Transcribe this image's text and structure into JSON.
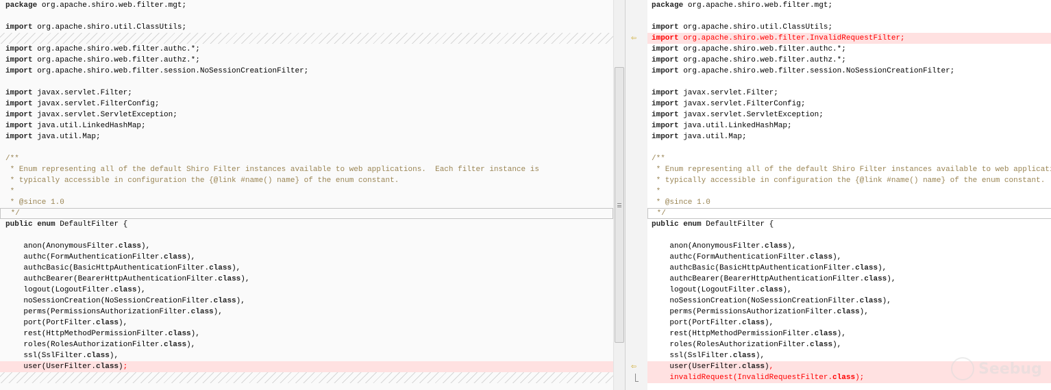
{
  "colors": {
    "added_bg": "#ffe1e1",
    "changed_text": "#ff0000",
    "comment": "#9a8554",
    "marker": "#c9a21a"
  },
  "left": {
    "lines": [
      {
        "t": "package org.apache.shiro.web.filter.mgt;"
      },
      {
        "t": ""
      },
      {
        "t": "import org.apache.shiro.util.ClassUtils;"
      },
      {
        "t": "",
        "kind": "hatch"
      },
      {
        "t": "import org.apache.shiro.web.filter.authc.*;"
      },
      {
        "t": "import org.apache.shiro.web.filter.authz.*;"
      },
      {
        "t": "import org.apache.shiro.web.filter.session.NoSessionCreationFilter;"
      },
      {
        "t": ""
      },
      {
        "t": "import javax.servlet.Filter;"
      },
      {
        "t": "import javax.servlet.FilterConfig;"
      },
      {
        "t": "import javax.servlet.ServletException;"
      },
      {
        "t": "import java.util.LinkedHashMap;"
      },
      {
        "t": "import java.util.Map;"
      },
      {
        "t": ""
      },
      {
        "t": "/**",
        "kind": "com"
      },
      {
        "t": " * Enum representing all of the default Shiro Filter instances available to web applications.  Each filter instance is",
        "kind": "com"
      },
      {
        "t": " * typically accessible in configuration the {@link #name() name} of the enum constant.",
        "kind": "com"
      },
      {
        "t": " *",
        "kind": "com"
      },
      {
        "t": " * @since 1.0",
        "kind": "com"
      },
      {
        "t": " */",
        "kind": "com",
        "boxed": true
      },
      {
        "t": "public enum DefaultFilter {"
      },
      {
        "t": ""
      },
      {
        "t": "    anon(AnonymousFilter.class),"
      },
      {
        "t": "    authc(FormAuthenticationFilter.class),"
      },
      {
        "t": "    authcBasic(BasicHttpAuthenticationFilter.class),"
      },
      {
        "t": "    authcBearer(BearerHttpAuthenticationFilter.class),"
      },
      {
        "t": "    logout(LogoutFilter.class),"
      },
      {
        "t": "    noSessionCreation(NoSessionCreationFilter.class),"
      },
      {
        "t": "    perms(PermissionsAuthorizationFilter.class),"
      },
      {
        "t": "    port(PortFilter.class),"
      },
      {
        "t": "    rest(HttpMethodPermissionFilter.class),"
      },
      {
        "t": "    roles(RolesAuthorizationFilter.class),"
      },
      {
        "t": "    ssl(SslFilter.class),"
      },
      {
        "t": "    user(UserFilter.class)",
        "red": ";",
        "kind": "pink"
      },
      {
        "t": "",
        "kind": "hatch"
      }
    ]
  },
  "right": {
    "lines": [
      {
        "t": "package org.apache.shiro.web.filter.mgt;"
      },
      {
        "t": ""
      },
      {
        "t": "import org.apache.shiro.util.ClassUtils;"
      },
      {
        "t": "",
        "red": "import org.apache.shiro.web.filter.InvalidRequestFilter;",
        "kind": "pink"
      },
      {
        "t": "import org.apache.shiro.web.filter.authc.*;"
      },
      {
        "t": "import org.apache.shiro.web.filter.authz.*;"
      },
      {
        "t": "import org.apache.shiro.web.filter.session.NoSessionCreationFilter;"
      },
      {
        "t": ""
      },
      {
        "t": "import javax.servlet.Filter;"
      },
      {
        "t": "import javax.servlet.FilterConfig;"
      },
      {
        "t": "import javax.servlet.ServletException;"
      },
      {
        "t": "import java.util.LinkedHashMap;"
      },
      {
        "t": "import java.util.Map;"
      },
      {
        "t": ""
      },
      {
        "t": "/**",
        "kind": "com"
      },
      {
        "t": " * Enum representing all of the default Shiro Filter instances available to web applications.  Each filter instance is",
        "kind": "com"
      },
      {
        "t": " * typically accessible in configuration the {@link #name() name} of the enum constant.",
        "kind": "com"
      },
      {
        "t": " *",
        "kind": "com"
      },
      {
        "t": " * @since 1.0",
        "kind": "com"
      },
      {
        "t": " */",
        "kind": "com",
        "boxed": true
      },
      {
        "t": "public enum DefaultFilter {"
      },
      {
        "t": ""
      },
      {
        "t": "    anon(AnonymousFilter.class),"
      },
      {
        "t": "    authc(FormAuthenticationFilter.class),"
      },
      {
        "t": "    authcBasic(BasicHttpAuthenticationFilter.class),"
      },
      {
        "t": "    authcBearer(BearerHttpAuthenticationFilter.class),"
      },
      {
        "t": "    logout(LogoutFilter.class),"
      },
      {
        "t": "    noSessionCreation(NoSessionCreationFilter.class),"
      },
      {
        "t": "    perms(PermissionsAuthorizationFilter.class),"
      },
      {
        "t": "    port(PortFilter.class),"
      },
      {
        "t": "    rest(HttpMethodPermissionFilter.class),"
      },
      {
        "t": "    roles(RolesAuthorizationFilter.class),"
      },
      {
        "t": "    ssl(SslFilter.class),"
      },
      {
        "t": "    user(UserFilter.class)",
        "red": ",",
        "kind": "pink"
      },
      {
        "t": "    ",
        "red": "invalidRequest(InvalidRequestFilter.class);",
        "kind": "pink"
      }
    ]
  },
  "gutter": {
    "markers": [
      {
        "row": 3,
        "icon": "change-arrow-icon"
      },
      {
        "row": 33,
        "icon": "change-arrow-icon"
      }
    ],
    "arrow_glyph": "⇦"
  },
  "watermark": {
    "text": "Seebug"
  }
}
